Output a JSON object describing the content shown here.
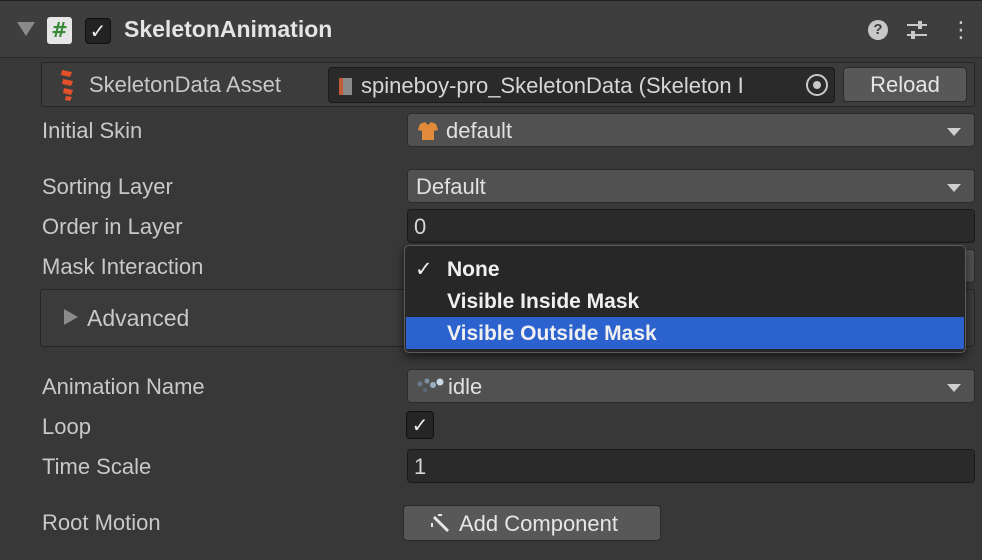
{
  "component": {
    "title": "SkeletonAnimation",
    "enabled_mark": "✓",
    "script_icon_glyph": "#",
    "help_glyph": "?",
    "menu_glyph": "⋮"
  },
  "asset": {
    "label": "SkeletonData Asset",
    "value": "spineboy-pro_SkeletonData (Skeleton I",
    "reload_label": "Reload"
  },
  "properties": {
    "initial_skin": {
      "label": "Initial Skin",
      "value": "default"
    },
    "sorting_layer": {
      "label": "Sorting Layer",
      "value": "Default"
    },
    "order_in_layer": {
      "label": "Order in Layer",
      "value": "0"
    },
    "mask_interaction": {
      "label": "Mask Interaction"
    },
    "advanced": {
      "label": "Advanced"
    },
    "animation_name": {
      "label": "Animation Name",
      "value": "idle"
    },
    "loop": {
      "label": "Loop",
      "checked_mark": "✓"
    },
    "time_scale": {
      "label": "Time Scale",
      "value": "1"
    },
    "root_motion": {
      "label": "Root Motion"
    }
  },
  "add_component": {
    "label": "Add Component"
  },
  "mask_popup": {
    "items": [
      {
        "label": "None",
        "checked": true,
        "check_mark": "✓"
      },
      {
        "label": "Visible Inside Mask",
        "checked": false
      },
      {
        "label": "Visible Outside Mask",
        "checked": false,
        "highlighted": true
      }
    ]
  },
  "colors": {
    "background": "#383838",
    "highlight": "#2c62cd",
    "field": "#2a2a2a",
    "dropdown": "#515151"
  }
}
